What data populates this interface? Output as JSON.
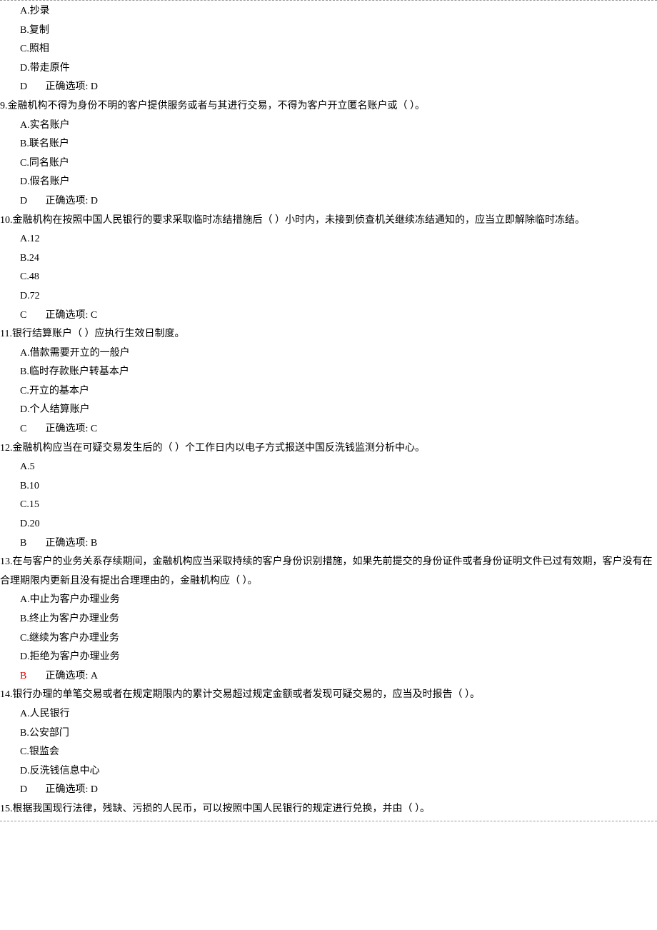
{
  "q8_tail": {
    "options": [
      "A.抄录",
      "B.复制",
      "C.照相",
      "D.带走原件"
    ],
    "given": "D",
    "correct_label": "正确选项: D"
  },
  "questions": [
    {
      "num": "9.",
      "text": "金融机构不得为身份不明的客户提供服务或者与其进行交易，不得为客户开立匿名账户或（ ）。",
      "options": [
        "A.实名账户",
        "B.联名账户",
        "C.同名账户",
        "D.假名账户"
      ],
      "given": "D",
      "correct_label": "正确选项: D",
      "wrong": false
    },
    {
      "num": "10.",
      "text": "金融机构在按照中国人民银行的要求采取临时冻结措施后（ ）小时内，未接到侦查机关继续冻结通知的，应当立即解除临时冻结。",
      "options": [
        "A.12",
        "B.24",
        "C.48",
        "D.72"
      ],
      "given": "C",
      "correct_label": "正确选项: C",
      "wrong": false
    },
    {
      "num": "11.",
      "text": "银行结算账户（ ）应执行生效日制度。",
      "options": [
        "A.借款需要开立的一般户",
        "B.临时存款账户转基本户",
        "C.开立的基本户",
        "D.个人结算账户"
      ],
      "given": "C",
      "correct_label": "正确选项: C",
      "wrong": false
    },
    {
      "num": "12.",
      "text": "金融机构应当在可疑交易发生后的（ ）个工作日内以电子方式报送中国反洗钱监测分析中心。",
      "options": [
        "A.5",
        "B.10",
        "C.15",
        "D.20"
      ],
      "given": "B",
      "correct_label": "正确选项: B",
      "wrong": false
    },
    {
      "num": "13.",
      "text": "在与客户的业务关系存续期间，金融机构应当采取持续的客户身份识别措施，如果先前提交的身份证件或者身份证明文件已过有效期，客户没有在合理期限内更新且没有提出合理理由的，金融机构应（ ）。",
      "options": [
        "A.中止为客户办理业务",
        "B.终止为客户办理业务",
        "C.继续为客户办理业务",
        "D.拒绝为客户办理业务"
      ],
      "given": "B",
      "correct_label": "正确选项: A",
      "wrong": true
    },
    {
      "num": "14.",
      "text": "银行办理的单笔交易或者在规定期限内的累计交易超过规定金额或者发现可疑交易的，应当及时报告（ ）。",
      "options": [
        "A.人民银行",
        "B.公安部门",
        "C.银监会",
        "D.反洗钱信息中心"
      ],
      "given": "D",
      "correct_label": "正确选项: D",
      "wrong": false
    }
  ],
  "q15_head": {
    "num": "15.",
    "text": "根据我国现行法律，残缺、污损的人民币，可以按照中国人民银行的规定进行兑换，并由（ ）。"
  }
}
